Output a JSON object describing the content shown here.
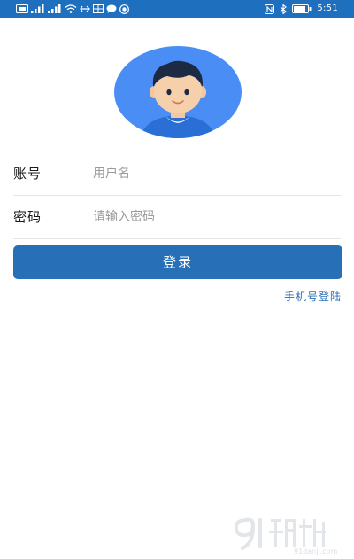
{
  "status_bar": {
    "time": "5:51",
    "icons_left": [
      "sim-icon",
      "signal-icon",
      "signal-icon",
      "wifi-icon",
      "usb-icon",
      "image-icon",
      "chat-icon",
      "app-icon"
    ],
    "icons_right": [
      "nfc-icon",
      "bluetooth-icon",
      "battery-icon"
    ],
    "background": "#1f6fbf"
  },
  "avatar": {
    "icon": "user-avatar-icon",
    "background": "#4a8ef5"
  },
  "form": {
    "account": {
      "label": "账号",
      "placeholder": "用户名",
      "value": ""
    },
    "password": {
      "label": "密码",
      "placeholder": "请输入密码",
      "value": ""
    }
  },
  "login_button": {
    "label": "登录",
    "color": "#2770b8"
  },
  "phone_login_link": {
    "label": "手机号登陆"
  }
}
